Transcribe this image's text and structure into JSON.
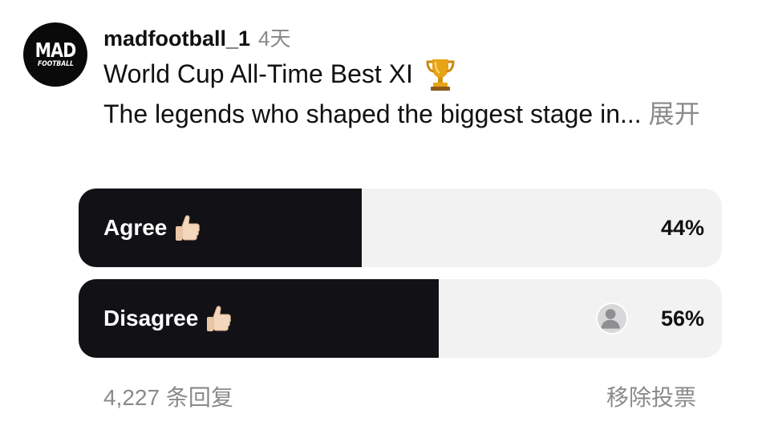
{
  "post": {
    "avatar_logo_top": "MAD",
    "avatar_logo_bottom": "FOOTBALL",
    "username": "madfootball_1",
    "time": "4天",
    "title": "World Cup All-Time Best XI",
    "description": "The legends who shaped the biggest stage in...",
    "more_label": "展开"
  },
  "poll": {
    "options": [
      {
        "label": "Agree",
        "percent_label": "44%",
        "fill_fraction": 0.44,
        "icon": "thumbs-up-icon"
      },
      {
        "label": "Disagree",
        "percent_label": "56%",
        "fill_fraction": 0.56,
        "icon": "thumbs-up-icon",
        "selected": true
      }
    ]
  },
  "footer": {
    "replies": "4,227 条回复",
    "remove_vote": "移除投票"
  },
  "colors": {
    "fill": "#121216",
    "track": "#f2f2f2",
    "muted_text": "#8a8a8a"
  }
}
